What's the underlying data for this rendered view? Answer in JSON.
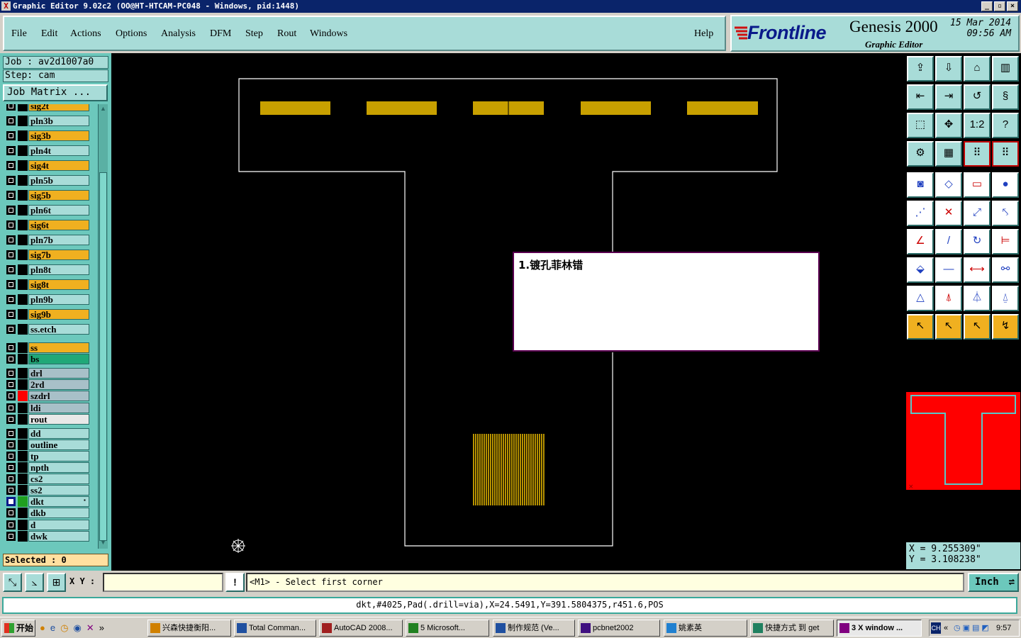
{
  "window": {
    "title": "Graphic Editor 9.02c2  (OO@HT-HTCAM-PC048 - Windows, pid:1448)"
  },
  "menu": [
    {
      "label": "File"
    },
    {
      "label": "Edit"
    },
    {
      "label": "Actions"
    },
    {
      "label": "Options"
    },
    {
      "label": "Analysis"
    },
    {
      "label": "DFM"
    },
    {
      "label": "Step"
    },
    {
      "label": "Rout"
    },
    {
      "label": "Windows"
    }
  ],
  "help_label": "Help",
  "brand": {
    "company": "Frontline",
    "product": "Genesis 2000",
    "subtitle": "Graphic Editor",
    "date": "15 Mar 2014",
    "time": "09:56 AM"
  },
  "job": {
    "job_label": "Job : av2d1007a0",
    "step_label": "Step: cam",
    "matrix_button": "Job Matrix ..."
  },
  "layers": [
    {
      "name": "sig2t",
      "color": "#f0b020"
    },
    {
      "name": "pln3b",
      "color": "#a8dcd8"
    },
    {
      "name": "sig3b",
      "color": "#f0b020"
    },
    {
      "name": "pln4t",
      "color": "#a8dcd8"
    },
    {
      "name": "sig4t",
      "color": "#f0b020"
    },
    {
      "name": "pln5b",
      "color": "#a8dcd8"
    },
    {
      "name": "sig5b",
      "color": "#f0b020"
    },
    {
      "name": "pln6t",
      "color": "#a8dcd8"
    },
    {
      "name": "sig6t",
      "color": "#f0b020"
    },
    {
      "name": "pln7b",
      "color": "#a8dcd8"
    },
    {
      "name": "sig7b",
      "color": "#f0b020"
    },
    {
      "name": "pln8t",
      "color": "#a8dcd8"
    },
    {
      "name": "sig8t",
      "color": "#f0b020"
    },
    {
      "name": "pln9b",
      "color": "#a8dcd8"
    },
    {
      "name": "sig9b",
      "color": "#f0b020"
    },
    {
      "name": "ss.etch",
      "color": "#a8dcd8"
    },
    {
      "name": "ss",
      "color": "#f0b020"
    },
    {
      "name": "bs",
      "color": "#20a878"
    },
    {
      "name": "drl",
      "color": "#a8c0c8"
    },
    {
      "name": "2rd",
      "color": "#a8c0c8"
    },
    {
      "name": "szdrl",
      "color": "#a8c0c8",
      "swatch": "#ff0000"
    },
    {
      "name": "ldi",
      "color": "#a8c0c8"
    },
    {
      "name": "rout",
      "color": "#e8e8e8"
    },
    {
      "name": "dd",
      "color": "#a8dcd8"
    },
    {
      "name": "outline",
      "color": "#a8dcd8"
    },
    {
      "name": "tp",
      "color": "#a8dcd8"
    },
    {
      "name": "npth",
      "color": "#a8dcd8"
    },
    {
      "name": "cs2",
      "color": "#a8dcd8"
    },
    {
      "name": "ss2",
      "color": "#a8dcd8"
    },
    {
      "name": "dkt",
      "color": "#a8dcd8",
      "swatch": "#20a020",
      "active": true
    },
    {
      "name": "dkb",
      "color": "#a8dcd8"
    },
    {
      "name": "d",
      "color": "#a8dcd8"
    },
    {
      "name": "dwk",
      "color": "#a8dcd8"
    }
  ],
  "selected_label": "Selected : 0",
  "note": {
    "text": "1.镀孔菲林错"
  },
  "coords": {
    "x": "X = 9.255309\"",
    "y": "Y = 3.108238\""
  },
  "command": {
    "xy_label": "X Y :",
    "xy_value": "",
    "prompt": "<M1> - Select first corner",
    "unit": "Inch"
  },
  "status_line": "dkt,#4025,Pad(.drill=via),X=24.5491,Y=391.5804375,r451.6,POS",
  "taskbar": {
    "start": "开始",
    "tasks": [
      {
        "label": "兴森快捷衡阳..."
      },
      {
        "label": "Total Comman..."
      },
      {
        "label": "AutoCAD 2008..."
      },
      {
        "label": "5 Microsoft..."
      },
      {
        "label": "制作规范  (Ve..."
      },
      {
        "label": "pcbnet2002"
      },
      {
        "label": "姚素英"
      },
      {
        "label": "快捷方式 到 get"
      },
      {
        "label": "3 X window ..."
      }
    ],
    "clock": "9:57",
    "lang": "CH"
  },
  "accent_colors": {
    "panel": "#a8dcd8",
    "signal": "#f0b020",
    "board_outline": "#ffffff",
    "pad": "#c8a000"
  }
}
